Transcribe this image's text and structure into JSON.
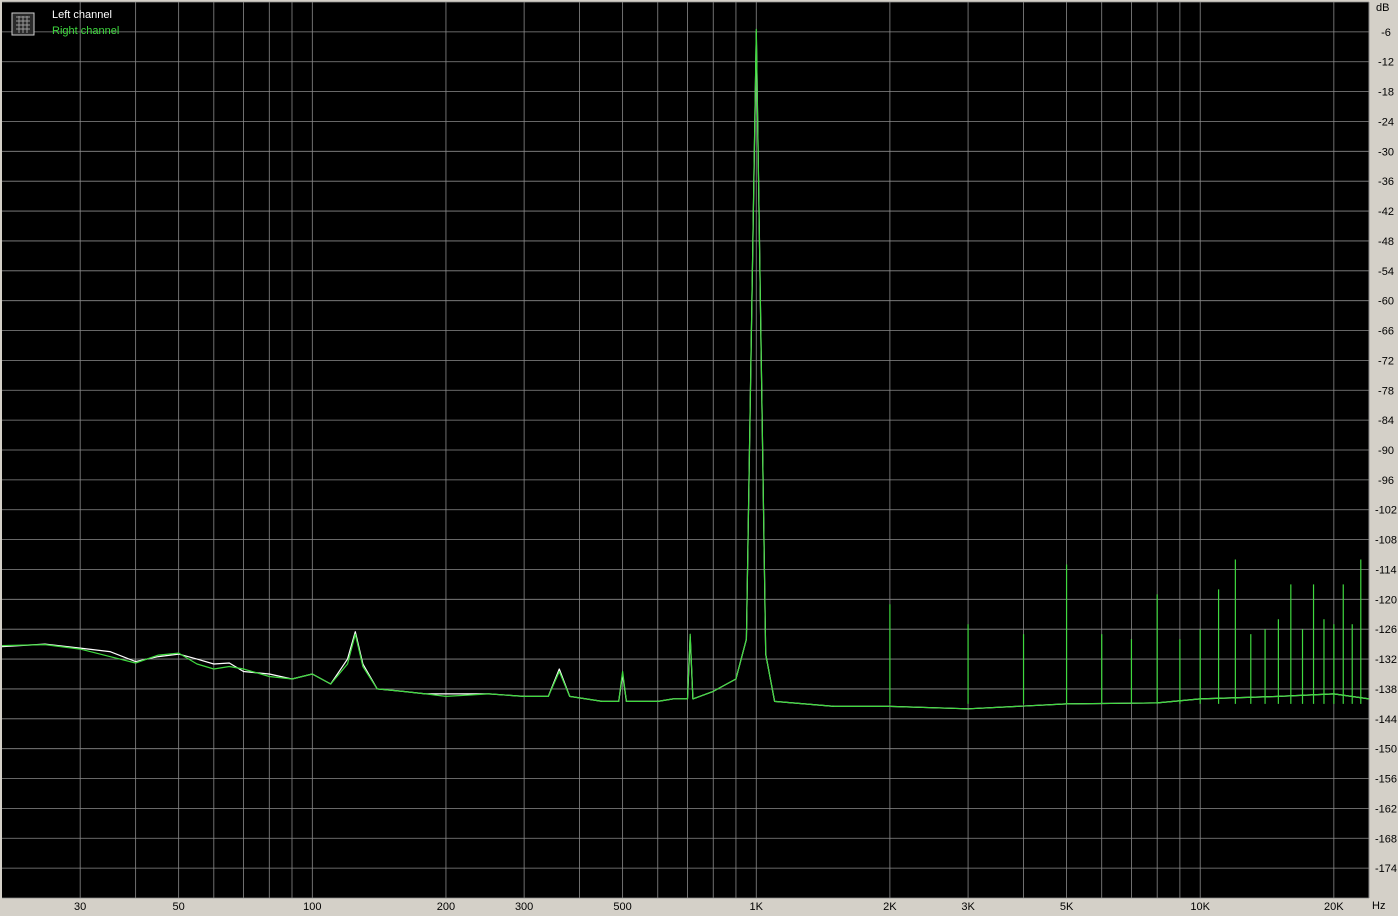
{
  "chart_data": {
    "type": "line",
    "title": "",
    "xlabel": "Hz",
    "ylabel": "dB",
    "x_scale": "log",
    "xlim": [
      20,
      24000
    ],
    "ylim": [
      -180,
      0
    ],
    "grid": true,
    "legend": "top-left",
    "background": "#000000",
    "y_ticks": [
      -6,
      -12,
      -18,
      -24,
      -30,
      -36,
      -42,
      -48,
      -54,
      -60,
      -66,
      -72,
      -78,
      -84,
      -90,
      -96,
      -102,
      -108,
      -114,
      -120,
      -126,
      -132,
      -138,
      -144,
      -150,
      -156,
      -162,
      -168,
      -174
    ],
    "x_ticks": [
      {
        "value": 30,
        "label": "30"
      },
      {
        "value": 50,
        "label": "50"
      },
      {
        "value": 100,
        "label": "100"
      },
      {
        "value": 200,
        "label": "200"
      },
      {
        "value": 300,
        "label": "300"
      },
      {
        "value": 500,
        "label": "500"
      },
      {
        "value": 1000,
        "label": "1K"
      },
      {
        "value": 2000,
        "label": "2K"
      },
      {
        "value": 3000,
        "label": "3K"
      },
      {
        "value": 5000,
        "label": "5K"
      },
      {
        "value": 10000,
        "label": "10K"
      },
      {
        "value": 20000,
        "label": "20K"
      }
    ],
    "series": [
      {
        "name": "Left channel",
        "color": "#ffffff",
        "points": [
          [
            20,
            -129.5
          ],
          [
            25,
            -129
          ],
          [
            30,
            -129.8
          ],
          [
            35,
            -130.5
          ],
          [
            40,
            -132.5
          ],
          [
            45,
            -131.5
          ],
          [
            50,
            -131
          ],
          [
            55,
            -132
          ],
          [
            60,
            -133
          ],
          [
            65,
            -132.8
          ],
          [
            70,
            -134.5
          ],
          [
            80,
            -135
          ],
          [
            90,
            -136
          ],
          [
            100,
            -135
          ],
          [
            110,
            -137
          ],
          [
            120,
            -132
          ],
          [
            125,
            -126.5
          ],
          [
            130,
            -133
          ],
          [
            140,
            -138
          ],
          [
            160,
            -138.5
          ],
          [
            180,
            -139
          ],
          [
            200,
            -139
          ],
          [
            250,
            -139
          ],
          [
            300,
            -139.5
          ],
          [
            340,
            -139.5
          ],
          [
            360,
            -134
          ],
          [
            380,
            -139.5
          ],
          [
            450,
            -140.5
          ],
          [
            490,
            -140.5
          ],
          [
            500,
            -135
          ],
          [
            510,
            -140.5
          ],
          [
            600,
            -140.5
          ],
          [
            650,
            -140
          ],
          [
            700,
            -140
          ],
          [
            710,
            -127.5
          ],
          [
            720,
            -140
          ],
          [
            800,
            -138.5
          ],
          [
            900,
            -136
          ],
          [
            950,
            -128
          ],
          [
            1000,
            -6
          ],
          [
            1050,
            -131
          ],
          [
            1100,
            -140.5
          ],
          [
            1500,
            -141.5
          ],
          [
            2000,
            -141.5
          ],
          [
            3000,
            -142
          ],
          [
            5000,
            -141
          ],
          [
            8000,
            -140.8
          ],
          [
            10000,
            -140
          ],
          [
            15000,
            -139.5
          ],
          [
            20000,
            -139
          ],
          [
            24000,
            -140
          ]
        ]
      },
      {
        "name": "Right channel",
        "color": "#3fd93f",
        "points": [
          [
            20,
            -129.3
          ],
          [
            25,
            -129.1
          ],
          [
            30,
            -130
          ],
          [
            35,
            -131.5
          ],
          [
            40,
            -132.8
          ],
          [
            45,
            -131.2
          ],
          [
            50,
            -130.8
          ],
          [
            55,
            -133
          ],
          [
            60,
            -134
          ],
          [
            65,
            -133.5
          ],
          [
            70,
            -134
          ],
          [
            80,
            -135.5
          ],
          [
            90,
            -136
          ],
          [
            100,
            -135
          ],
          [
            110,
            -137
          ],
          [
            120,
            -133
          ],
          [
            125,
            -127
          ],
          [
            130,
            -133.5
          ],
          [
            140,
            -138
          ],
          [
            160,
            -138.5
          ],
          [
            180,
            -139
          ],
          [
            200,
            -139.5
          ],
          [
            250,
            -139
          ],
          [
            300,
            -139.5
          ],
          [
            340,
            -139.5
          ],
          [
            360,
            -134.5
          ],
          [
            380,
            -139.5
          ],
          [
            450,
            -140.5
          ],
          [
            490,
            -140.5
          ],
          [
            500,
            -134.5
          ],
          [
            510,
            -140.5
          ],
          [
            600,
            -140.5
          ],
          [
            650,
            -140
          ],
          [
            700,
            -140
          ],
          [
            710,
            -127
          ],
          [
            720,
            -140
          ],
          [
            800,
            -138.5
          ],
          [
            900,
            -136
          ],
          [
            950,
            -128
          ],
          [
            1000,
            -5.5
          ],
          [
            1050,
            -131
          ],
          [
            1100,
            -140.5
          ],
          [
            1500,
            -141.5
          ],
          [
            2000,
            -141.5
          ],
          [
            3000,
            -142
          ],
          [
            5000,
            -141
          ],
          [
            8000,
            -140.8
          ],
          [
            10000,
            -140
          ],
          [
            15000,
            -139.5
          ],
          [
            20000,
            -139
          ],
          [
            24000,
            -140
          ]
        ],
        "harmonic_spikes": [
          [
            2000,
            -121
          ],
          [
            3000,
            -125
          ],
          [
            4000,
            -127
          ],
          [
            5000,
            -113
          ],
          [
            6000,
            -127
          ],
          [
            7000,
            -128
          ],
          [
            8000,
            -119
          ],
          [
            9000,
            -128
          ],
          [
            10000,
            -126
          ],
          [
            11000,
            -118
          ],
          [
            12000,
            -112
          ],
          [
            13000,
            -127
          ],
          [
            14000,
            -126
          ],
          [
            15000,
            -124
          ],
          [
            16000,
            -117
          ],
          [
            17000,
            -126
          ],
          [
            18000,
            -117
          ],
          [
            19000,
            -124
          ],
          [
            20000,
            -125
          ],
          [
            21000,
            -117
          ],
          [
            22000,
            -125
          ],
          [
            23000,
            -112
          ]
        ]
      }
    ]
  }
}
